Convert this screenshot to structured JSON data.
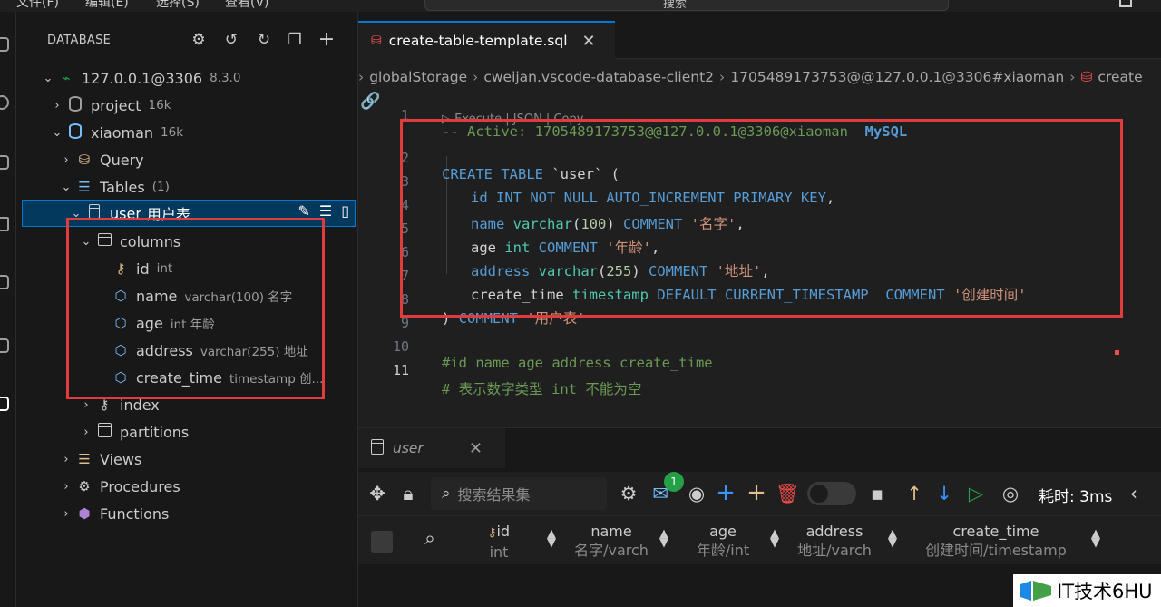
{
  "menubar": {
    "items": [
      "文件(F)",
      "编辑(E)",
      "选择(S)",
      "查看(V)"
    ],
    "search_placeholder": "搜索"
  },
  "sidebar": {
    "header": "DATABASE",
    "toolbar_icons": [
      "gear-icon",
      "history-icon",
      "refresh-icon",
      "collapse-icon",
      "add-icon"
    ],
    "connection": {
      "label": "127.0.0.1@3306",
      "version": "8.3.0"
    },
    "databases": [
      {
        "label": "project",
        "size": "16k"
      },
      {
        "label": "xiaoman",
        "size": "16k"
      }
    ],
    "query": "Query",
    "tables": {
      "label": "Tables",
      "count": "(1)"
    },
    "table": {
      "label": "user",
      "comment": "用户表"
    },
    "columns_label": "columns",
    "columns": [
      {
        "name": "id",
        "type": "int"
      },
      {
        "name": "name",
        "type": "varchar(100) 名字"
      },
      {
        "name": "age",
        "type": "int 年龄"
      },
      {
        "name": "address",
        "type": "varchar(255) 地址"
      },
      {
        "name": "create_time",
        "type": "timestamp 创..."
      }
    ],
    "index": "index",
    "partitions": "partitions",
    "views": "Views",
    "procedures": "Procedures",
    "functions": "Functions"
  },
  "editor": {
    "tab_label": "create-table-template.sql",
    "breadcrumb": [
      "globalStorage",
      "cweijan.vscode-database-client2",
      "1705489173753@@127.0.0.1@3306#xiaoman",
      "create"
    ],
    "codelens": "▷ Execute | JSON | Copy",
    "line_numbers": [
      "1",
      "2",
      "3",
      "4",
      "5",
      "6",
      "7",
      "8",
      "9",
      "10",
      "11"
    ],
    "lines": {
      "l1_comment": "-- Active: 1705489173753@@127.0.0.1@3306@xiaoman",
      "l1_db": "MySQL",
      "l2_a": "CREATE TABLE",
      "l2_b": " `user` (",
      "l3_a": "id",
      "l3_b": " INT NOT NULL AUTO_INCREMENT PRIMARY KEY",
      "l3_c": ",",
      "l4_a": "name",
      "l4_b": " varchar",
      "l4_c": "(",
      "l4_d": "100",
      "l4_e": ")",
      "l4_f": " COMMENT",
      "l4_g": " '名字'",
      "l4_h": ",",
      "l5_a": "age",
      "l5_b": " int",
      "l5_c": " COMMENT",
      "l5_d": " '年龄'",
      "l5_e": ",",
      "l6_a": "address",
      "l6_b": " varchar",
      "l6_c": "(",
      "l6_d": "255",
      "l6_e": ")",
      "l6_f": " COMMENT",
      "l6_g": " '地址'",
      "l6_h": ",",
      "l7_a": "create_time",
      "l7_b": " timestamp",
      "l7_c": " DEFAULT CURRENT_TIMESTAMP",
      "l7_d": "  COMMENT",
      "l7_e": " '创建时间'",
      "l8_a": ")",
      "l8_b": " COMMENT",
      "l8_c": " '用户表'",
      "l10": "#id name age address create_time",
      "l11": "# 表示数字类型 int 不能为空"
    }
  },
  "panel": {
    "tab_label": "user",
    "search_placeholder": "搜索结果集",
    "badge_count": "1",
    "elapsed_label": "耗时: 3ms",
    "columns": [
      {
        "name": "id",
        "type": "int"
      },
      {
        "name": "name",
        "type": "名字/varch"
      },
      {
        "name": "age",
        "type": "年龄/int"
      },
      {
        "name": "address",
        "type": "地址/varch"
      },
      {
        "name": "create_time",
        "type": "创建时间/timestamp"
      }
    ]
  },
  "watermark": {
    "text": "IT技术6HU"
  },
  "colors": {
    "accent": "#0078d4",
    "highlight_box": "#e23b3b",
    "keyword": "#569cd6",
    "string": "#ce9178",
    "comment": "#6a9955"
  }
}
